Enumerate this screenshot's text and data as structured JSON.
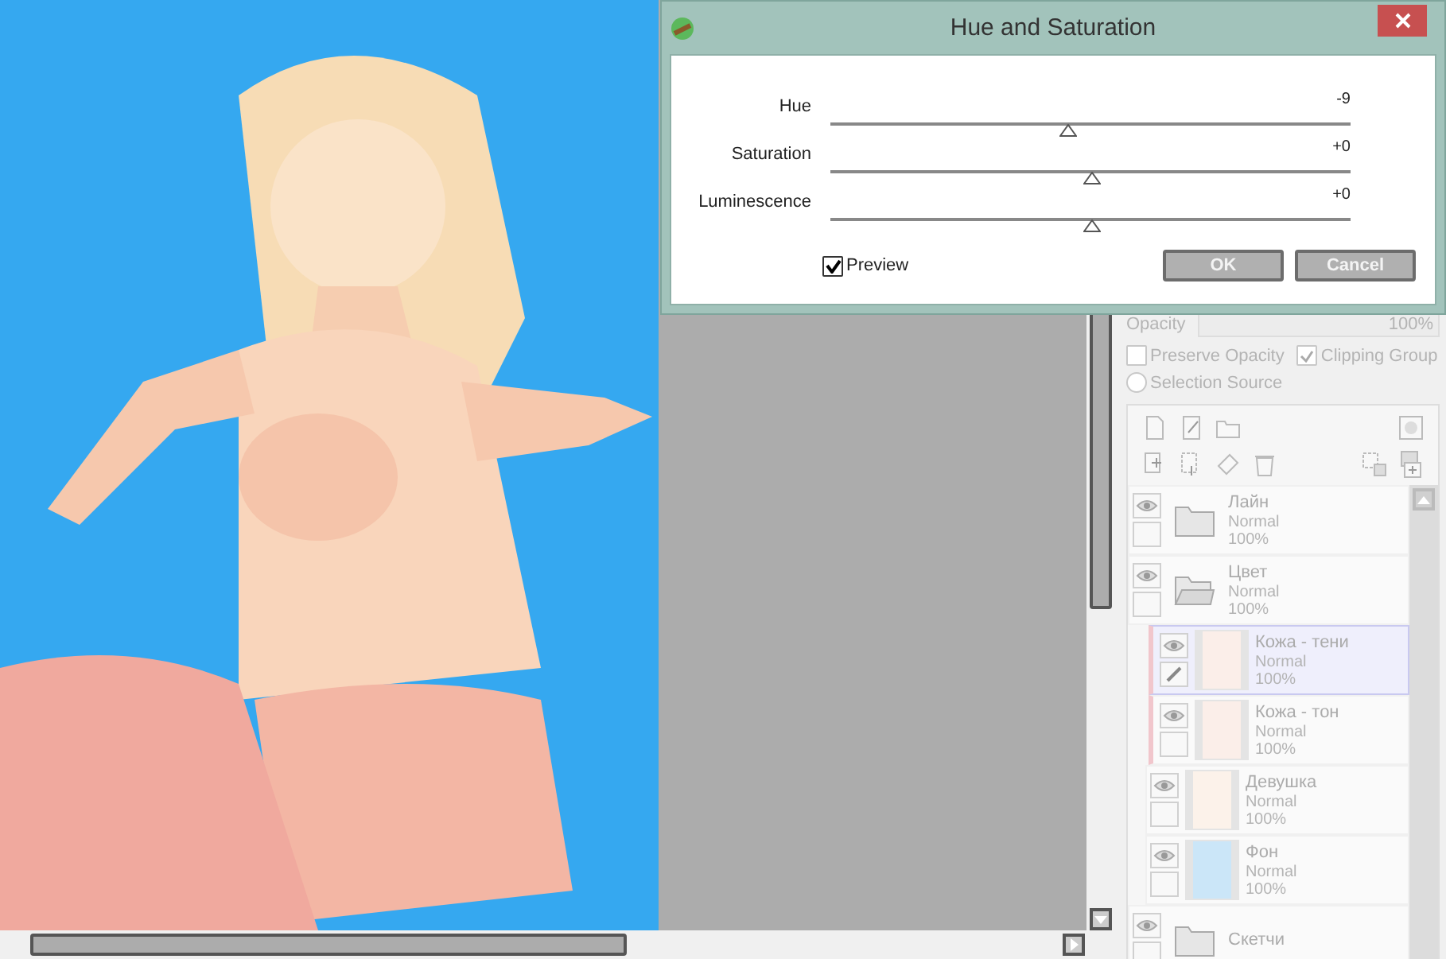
{
  "dialog": {
    "title": "Hue and Saturation",
    "sliders": [
      {
        "label": "Hue",
        "reading": "-9",
        "level": 0.456
      },
      {
        "label": "Saturation",
        "reading": "+0",
        "level": 0.5
      },
      {
        "label": "Luminescence",
        "reading": "+0",
        "level": 0.5
      }
    ],
    "preview": {
      "label": "Preview",
      "checked": true
    },
    "buttons": [
      "OK",
      "Cancel"
    ]
  },
  "layer_panel": {
    "opacity_label": "Opacity",
    "opacity_value": "100%",
    "options": [
      {
        "kind": "checkbox",
        "label": "Preserve Opacity",
        "checked": false
      },
      {
        "kind": "checkbox",
        "label": "Clipping Group",
        "checked": true
      },
      {
        "kind": "radio",
        "label": "Selection Source",
        "checked": false
      }
    ],
    "layers": [
      {
        "kind": "folder",
        "name": "Лайн",
        "mode": "Normal",
        "opacity": "100%",
        "expanded": false,
        "selected": false,
        "visible": true
      },
      {
        "kind": "folder",
        "name": "Цвет",
        "mode": "Normal",
        "opacity": "100%",
        "expanded": true,
        "selected": false,
        "visible": true,
        "children": [
          {
            "kind": "layer",
            "name": "Кожа - тени",
            "mode": "Normal",
            "opacity": "100%",
            "selected": true,
            "clipping": true,
            "visible": true,
            "color": "#fbeee9"
          },
          {
            "kind": "layer",
            "name": "Кожа - тон",
            "mode": "Normal",
            "opacity": "100%",
            "selected": false,
            "clipping": true,
            "visible": true,
            "color": "#fbeee9"
          },
          {
            "kind": "layer",
            "name": "Девушка",
            "mode": "Normal",
            "opacity": "100%",
            "selected": false,
            "clipping": false,
            "visible": true,
            "color": "#fcf2ea"
          },
          {
            "kind": "layer",
            "name": "Фон",
            "mode": "Normal",
            "opacity": "100%",
            "selected": false,
            "clipping": false,
            "visible": true,
            "color": "#cbe6f8"
          }
        ]
      },
      {
        "kind": "folder",
        "name": "Скетчи",
        "expanded": false,
        "selected": false,
        "visible": true
      }
    ]
  }
}
